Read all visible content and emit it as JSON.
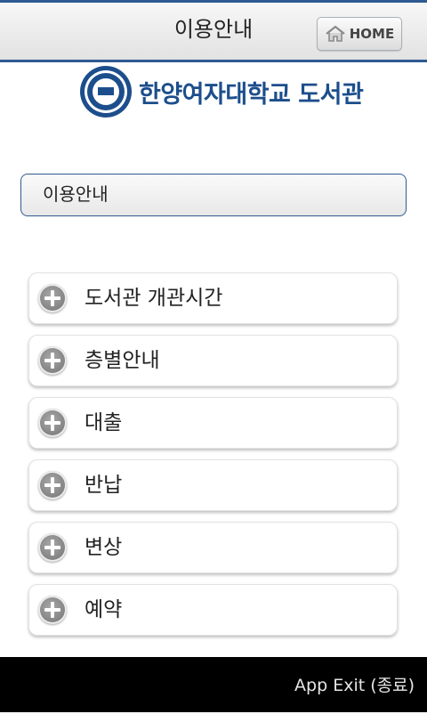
{
  "header": {
    "title": "이용안내",
    "home_label": "HOME"
  },
  "logo": {
    "name": "한양여자대학교 도서관"
  },
  "search": {
    "value": "이용안내"
  },
  "menu": [
    {
      "label": "도서관 개관시간",
      "icon": "plus-icon"
    },
    {
      "label": "층별안내",
      "icon": "plus-icon"
    },
    {
      "label": "대출",
      "icon": "plus-icon"
    },
    {
      "label": "반납",
      "icon": "plus-icon"
    },
    {
      "label": "변상",
      "icon": "plus-icon"
    },
    {
      "label": "예약",
      "icon": "plus-icon"
    }
  ],
  "footer": {
    "exit_label": "App Exit (종료)"
  },
  "colors": {
    "accent": "#2f5a91",
    "brand": "#1c4e8c",
    "footer_bg": "#000000"
  }
}
